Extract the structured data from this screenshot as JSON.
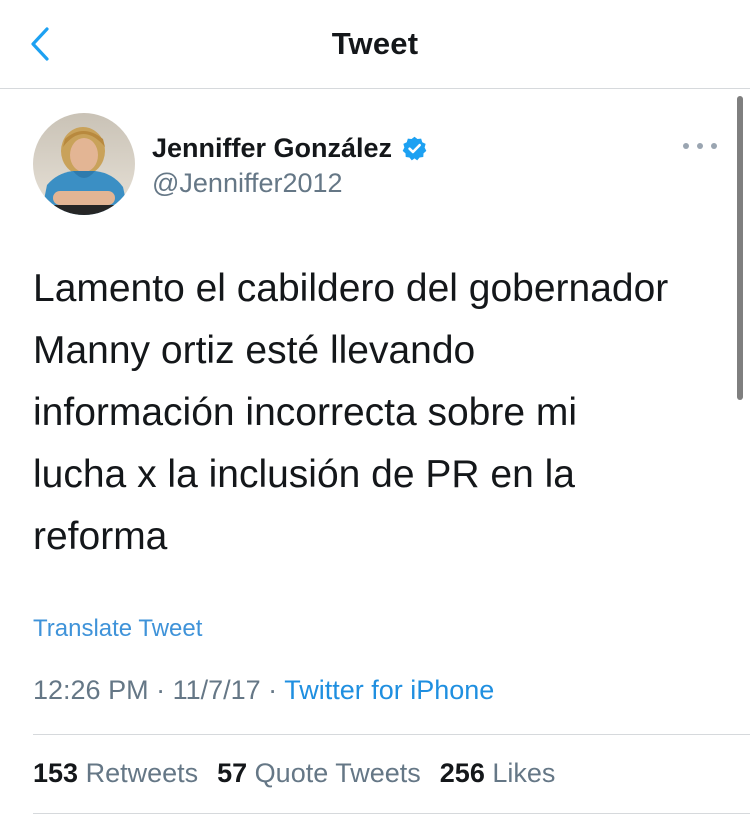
{
  "nav": {
    "title": "Tweet",
    "back_icon": "chevron-left-icon"
  },
  "colors": {
    "accent": "#1da1f2",
    "link": "#3f93d9",
    "text": "#14171a",
    "secondary": "#657786",
    "divider": "#d6d9dc"
  },
  "author": {
    "name": "Jenniffer González",
    "handle": "@Jenniffer2012",
    "verified_icon": "verified-badge-icon",
    "avatar": "avatar-photo"
  },
  "tweet": {
    "text": "Lamento el cabildero del gobernador\nManny ortiz esté llevando\ninformación incorrecta sobre mi\nlucha x la inclusión de PR  en la\nreforma",
    "translate_label": "Translate Tweet",
    "time": "12:26 PM",
    "separator": " · ",
    "date": "11/7/17",
    "source": "Twitter for iPhone"
  },
  "stats": {
    "retweets_count": "153",
    "retweets_label": " Retweets",
    "quotes_count": "57",
    "quotes_label": " Quote Tweets",
    "likes_count": "256",
    "likes_label": " Likes"
  },
  "more_icon": "more-horizontal-icon"
}
